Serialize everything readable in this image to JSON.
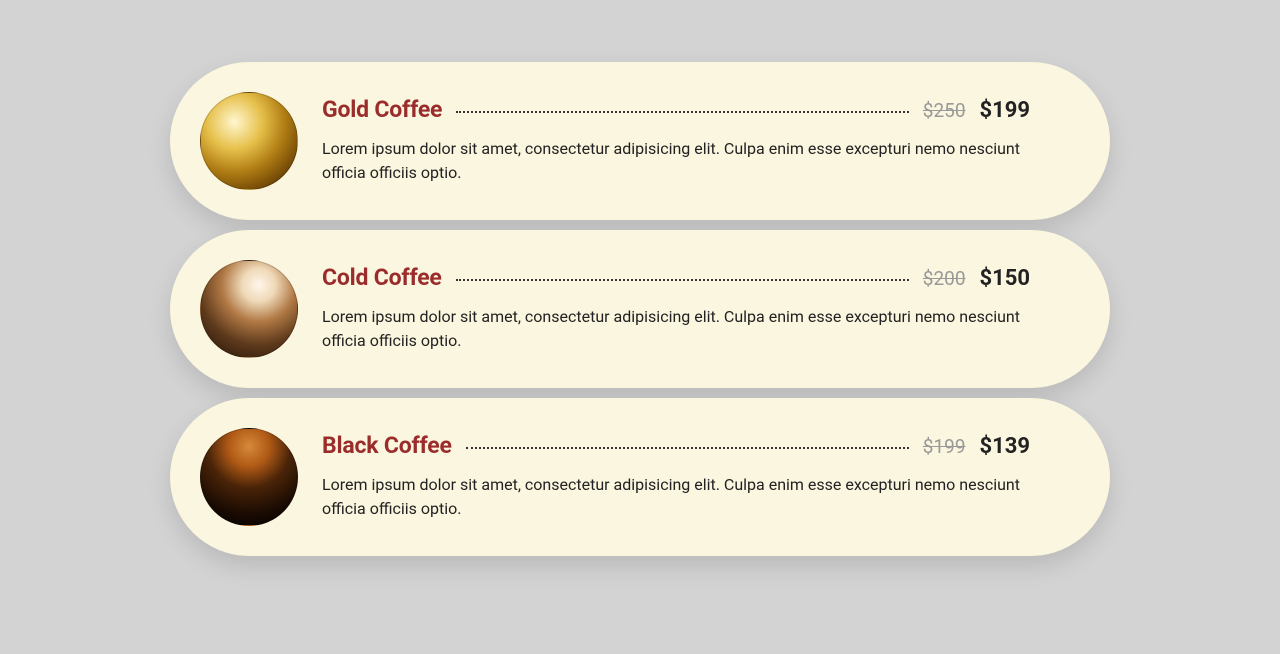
{
  "menu": [
    {
      "name": "Gold Coffee",
      "price_old": "$250",
      "price_new": "$199",
      "desc": "Lorem ipsum dolor sit amet, consectetur adipisicing elit. Culpa enim esse excepturi nemo nesciunt officia officiis optio."
    },
    {
      "name": "Cold Coffee",
      "price_old": "$200",
      "price_new": "$150",
      "desc": "Lorem ipsum dolor sit amet, consectetur adipisicing elit. Culpa enim esse excepturi nemo nesciunt officia officiis optio."
    },
    {
      "name": "Black Coffee",
      "price_old": "$199",
      "price_new": "$139",
      "desc": "Lorem ipsum dolor sit amet, consectetur adipisicing elit. Culpa enim esse excepturi nemo nesciunt officia officiis optio."
    }
  ]
}
